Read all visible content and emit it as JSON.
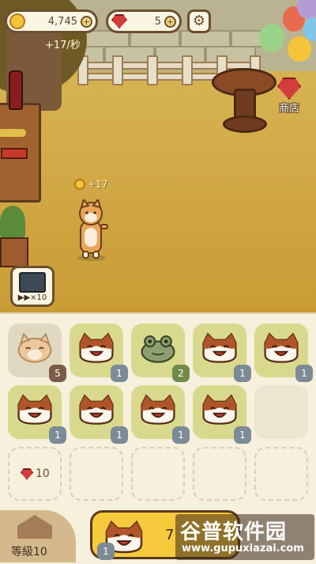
{
  "hud": {
    "coins": "4,745",
    "gems": "5",
    "income_rate": "+17/秒"
  },
  "shop": {
    "label": "商店"
  },
  "pet": {
    "coin_popup": "+17"
  },
  "gift": {
    "multiplier": "▶▶×10"
  },
  "board": {
    "rows": [
      [
        {
          "pet": "shiba",
          "level": "5",
          "state": "selected"
        },
        {
          "pet": "cat",
          "level": "1"
        },
        {
          "pet": "frog",
          "level": "2"
        },
        {
          "pet": "cat",
          "level": "1"
        },
        {
          "pet": "cat",
          "level": "1"
        }
      ],
      [
        {
          "pet": "cat",
          "level": "1"
        },
        {
          "pet": "cat",
          "level": "1"
        },
        {
          "pet": "cat",
          "level": "1"
        },
        {
          "pet": "cat",
          "level": "1"
        },
        {
          "pet": "",
          "level": "",
          "state": "empty"
        }
      ]
    ],
    "unlock_cost": "10"
  },
  "bottom": {
    "level_label": "等級10",
    "buy_level": "1",
    "buy_price_partial": "7"
  },
  "watermark": {
    "line1": "谷普软件园",
    "line2": "www.gupuxiazai.com"
  },
  "colors": {
    "slot_filled": "#d9d98e",
    "buy_button": "#f7c93d",
    "gem": "#d43d3d"
  }
}
